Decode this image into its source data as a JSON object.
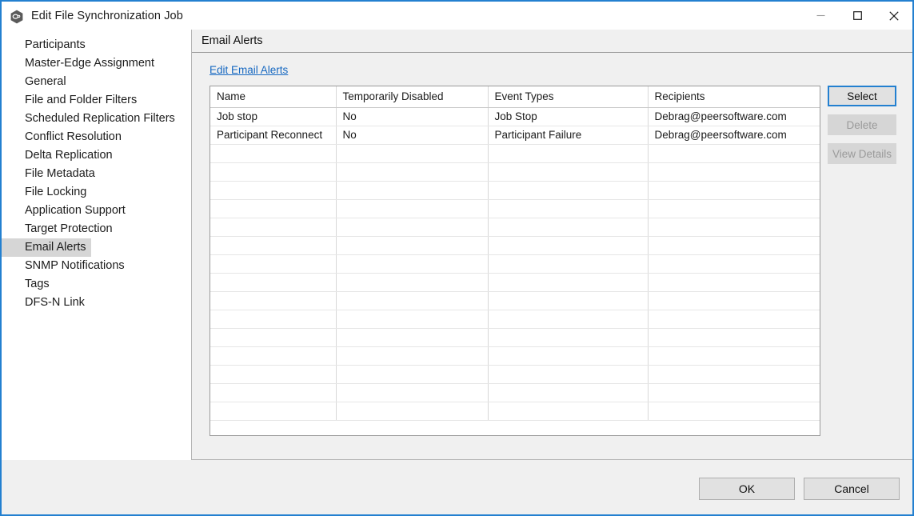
{
  "window": {
    "title": "Edit File Synchronization Job",
    "icon": "app-hexagon-icon",
    "accent_color": "#2380d0",
    "controls": [
      {
        "name": "minimize",
        "glyph": "minimize-icon"
      },
      {
        "name": "maximize",
        "glyph": "maximize-icon"
      },
      {
        "name": "close",
        "glyph": "close-icon"
      }
    ]
  },
  "sidebar": {
    "items": [
      {
        "label": "Participants",
        "selected": false
      },
      {
        "label": "Master-Edge Assignment",
        "selected": false
      },
      {
        "label": "General",
        "selected": false
      },
      {
        "label": "File and Folder Filters",
        "selected": false
      },
      {
        "label": "Scheduled Replication Filters",
        "selected": false
      },
      {
        "label": "Conflict Resolution",
        "selected": false
      },
      {
        "label": "Delta Replication",
        "selected": false
      },
      {
        "label": "File Metadata",
        "selected": false
      },
      {
        "label": "File Locking",
        "selected": false
      },
      {
        "label": "Application Support",
        "selected": false
      },
      {
        "label": "Target Protection",
        "selected": false
      },
      {
        "label": "Email Alerts",
        "selected": true
      },
      {
        "label": "SNMP Notifications",
        "selected": false
      },
      {
        "label": "Tags",
        "selected": false
      },
      {
        "label": "DFS-N Link",
        "selected": false
      }
    ]
  },
  "panel": {
    "title": "Email Alerts",
    "edit_link": "Edit Email Alerts",
    "link_color": "#1668c1"
  },
  "table": {
    "columns": [
      "Name",
      "Temporarily Disabled",
      "Event Types",
      "Recipients"
    ],
    "rows": [
      {
        "name": "Job stop",
        "temporarily_disabled": "No",
        "event_types": "Job Stop",
        "recipients": "Debrag@peersoftware.com"
      },
      {
        "name": "Participant Reconnect",
        "temporarily_disabled": "No",
        "event_types": "Participant Failure",
        "recipients": "Debrag@peersoftware.com"
      }
    ],
    "empty_row_count": 15
  },
  "side_buttons": [
    {
      "label": "Select",
      "state": "focused"
    },
    {
      "label": "Delete",
      "state": "disabled"
    },
    {
      "label": "View Details",
      "state": "disabled"
    }
  ],
  "footer_buttons": [
    {
      "label": "OK"
    },
    {
      "label": "Cancel"
    }
  ]
}
